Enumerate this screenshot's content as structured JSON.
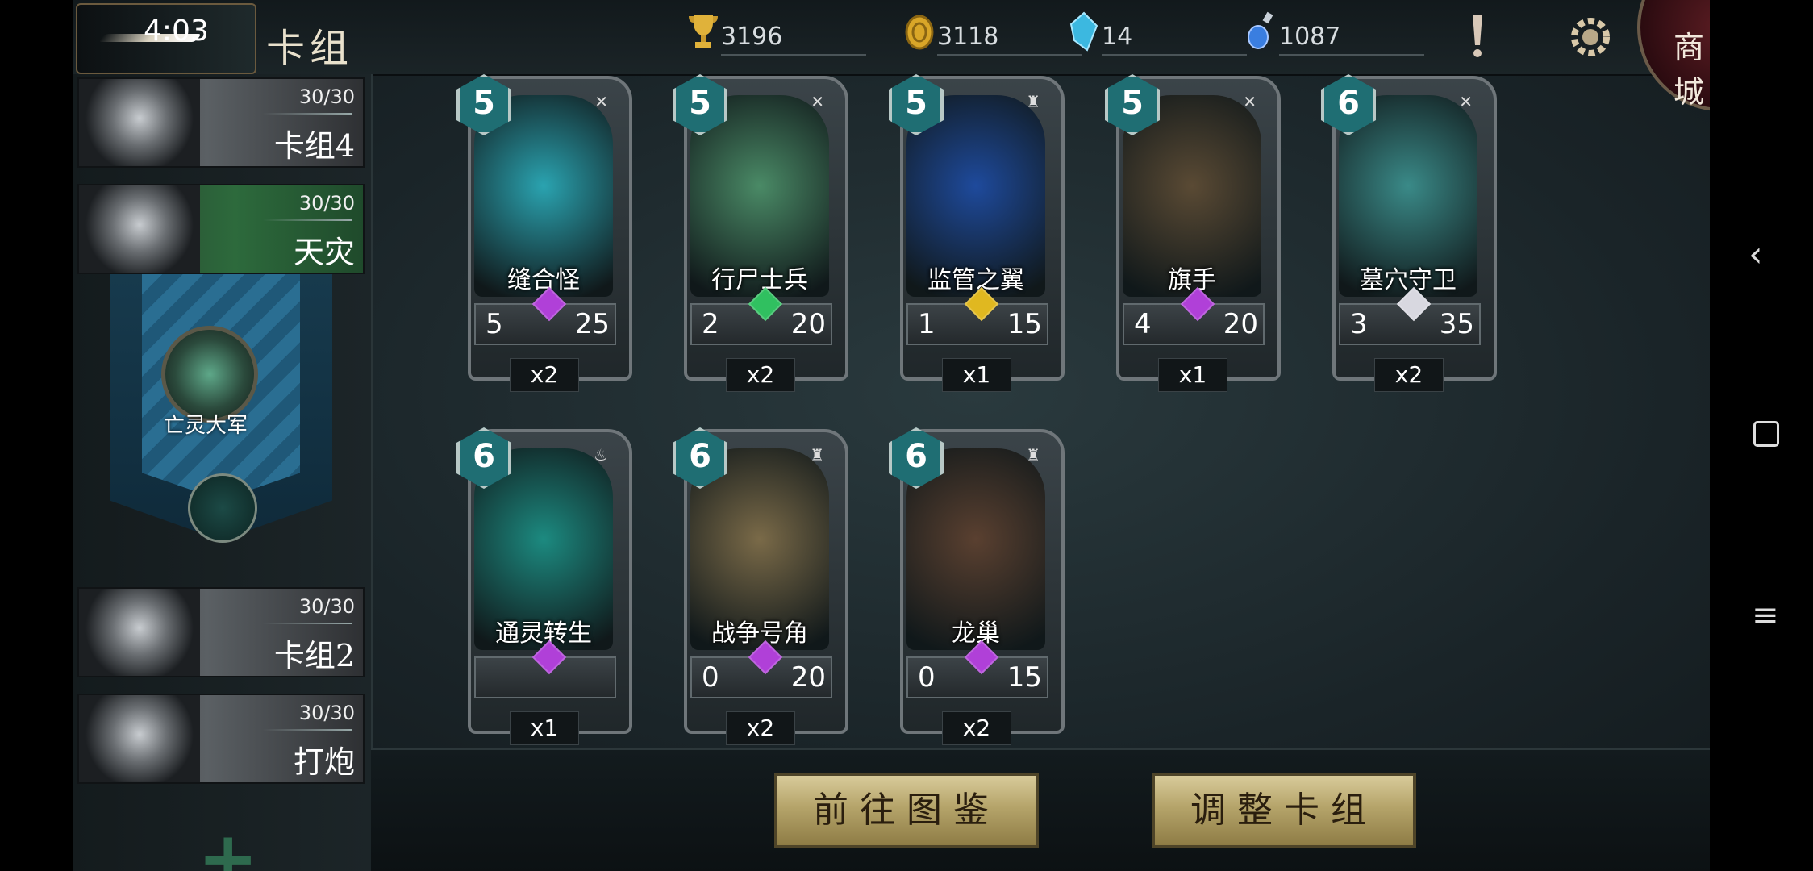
{
  "status": {
    "time": "4:03"
  },
  "header": {
    "title": "卡组",
    "resources": [
      {
        "icon": "trophy-icon",
        "value": "3196"
      },
      {
        "icon": "gold-coin-icon",
        "value": "3118"
      },
      {
        "icon": "crystal-icon",
        "value": "14"
      },
      {
        "icon": "potion-icon",
        "value": "1087"
      }
    ],
    "shop_label": "商城"
  },
  "sidebar": {
    "decks": [
      {
        "name": "卡组4",
        "count": "30/30"
      },
      {
        "name": "天灾",
        "count": "30/30"
      },
      {
        "name": "卡组2",
        "count": "30/30"
      },
      {
        "name": "打炮",
        "count": "30/30"
      }
    ],
    "faction_label": "亡灵大军"
  },
  "cards": [
    {
      "name": "缝合怪",
      "cost": "5",
      "attack": "5",
      "health": "25",
      "qty": "x2",
      "gem": "#b040d8",
      "portrait": "#2aa3b0",
      "type": "✕"
    },
    {
      "name": "行尸士兵",
      "cost": "5",
      "attack": "2",
      "health": "20",
      "qty": "x2",
      "gem": "#30c060",
      "portrait": "#4a8a66",
      "type": "✕"
    },
    {
      "name": "监管之翼",
      "cost": "5",
      "attack": "1",
      "health": "15",
      "qty": "x1",
      "gem": "#e0b820",
      "portrait": "#1e4a9c",
      "type": "♜"
    },
    {
      "name": "旗手",
      "cost": "5",
      "attack": "4",
      "health": "20",
      "qty": "x1",
      "gem": "#b040d8",
      "portrait": "#5a4a34",
      "type": "✕"
    },
    {
      "name": "墓穴守卫",
      "cost": "6",
      "attack": "3",
      "health": "35",
      "qty": "x2",
      "gem": "#d8d8e0",
      "portrait": "#3a8a88",
      "type": "✕"
    },
    {
      "name": "通灵转生",
      "cost": "6",
      "attack": "",
      "health": "",
      "qty": "x1",
      "gem": "#b040d8",
      "portrait": "#1c8a80",
      "type": "♨"
    },
    {
      "name": "战争号角",
      "cost": "6",
      "attack": "0",
      "health": "20",
      "qty": "x2",
      "gem": "#b040d8",
      "portrait": "#7a6a48",
      "type": "♜"
    },
    {
      "name": "龙巢",
      "cost": "6",
      "attack": "0",
      "health": "15",
      "qty": "x2",
      "gem": "#b040d8",
      "portrait": "#5a4030",
      "type": "♜"
    }
  ],
  "buttons": {
    "gallery": "前往图鉴",
    "adjust": "调整卡组"
  }
}
